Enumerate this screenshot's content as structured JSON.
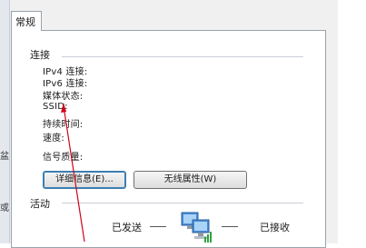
{
  "tab": {
    "general_label": "常规"
  },
  "gutter": {
    "text_1": "盆",
    "text_2": "或"
  },
  "connection": {
    "group_label": "连接",
    "fields": [
      "IPv4 连接:",
      "IPv6 连接:",
      "媒体状态:",
      "SSID:",
      "持续时间:",
      "速度:"
    ],
    "signal_quality_label": "信号质量:"
  },
  "buttons": {
    "details_label": "详细信息(E)...",
    "wireless_properties_label": "无线属性(W)"
  },
  "activity": {
    "group_label": "活动",
    "sent_label": "已发送",
    "received_label": "已接收"
  },
  "colors": {
    "annotation_arrow": "#d0021b",
    "accent_blue": "#3c7fb1"
  }
}
